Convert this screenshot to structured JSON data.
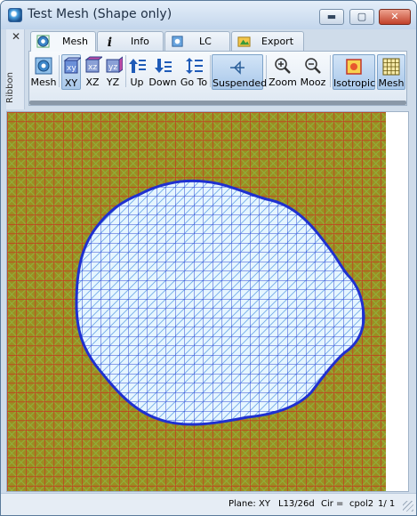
{
  "window": {
    "title": "Test Mesh (Shape only)",
    "buttons": {
      "minimize": "▬",
      "maximize": "▢",
      "close": "✕"
    }
  },
  "ribbon_panel": {
    "close": "✕",
    "label": "Ribbon"
  },
  "tabs": [
    {
      "label": "Mesh",
      "icon": "mesh-icon",
      "active": true
    },
    {
      "label": "Info",
      "icon": "info-icon",
      "active": false
    },
    {
      "label": "LC",
      "icon": "lc-icon",
      "active": false
    },
    {
      "label": "Export",
      "icon": "export-icon",
      "active": false
    }
  ],
  "toolbar": {
    "mesh": "Mesh",
    "xy": "XY",
    "xz": "XZ",
    "yz": "YZ",
    "up": "Up",
    "down": "Down",
    "goto": "Go To",
    "suspended": "Suspended",
    "zoom": "Zoom",
    "mooz": "Mooz",
    "isotropic": "Isotropic",
    "mesh_view": "Mesh",
    "selected": [
      "XY",
      "Suspended",
      "Isotropic",
      "Mesh"
    ]
  },
  "canvas": {
    "background_color": "#9c8d22",
    "grid_color": "#cc2a20",
    "shape_fill": "#e6f6ff",
    "shape_grid": "#2d47d6",
    "shape_outline": "#1f30d0"
  },
  "status": {
    "plane": "Plane: XY",
    "layer": "L13/26d",
    "cir": "Cir =",
    "material": "cpol2",
    "page": "1/ 1"
  }
}
